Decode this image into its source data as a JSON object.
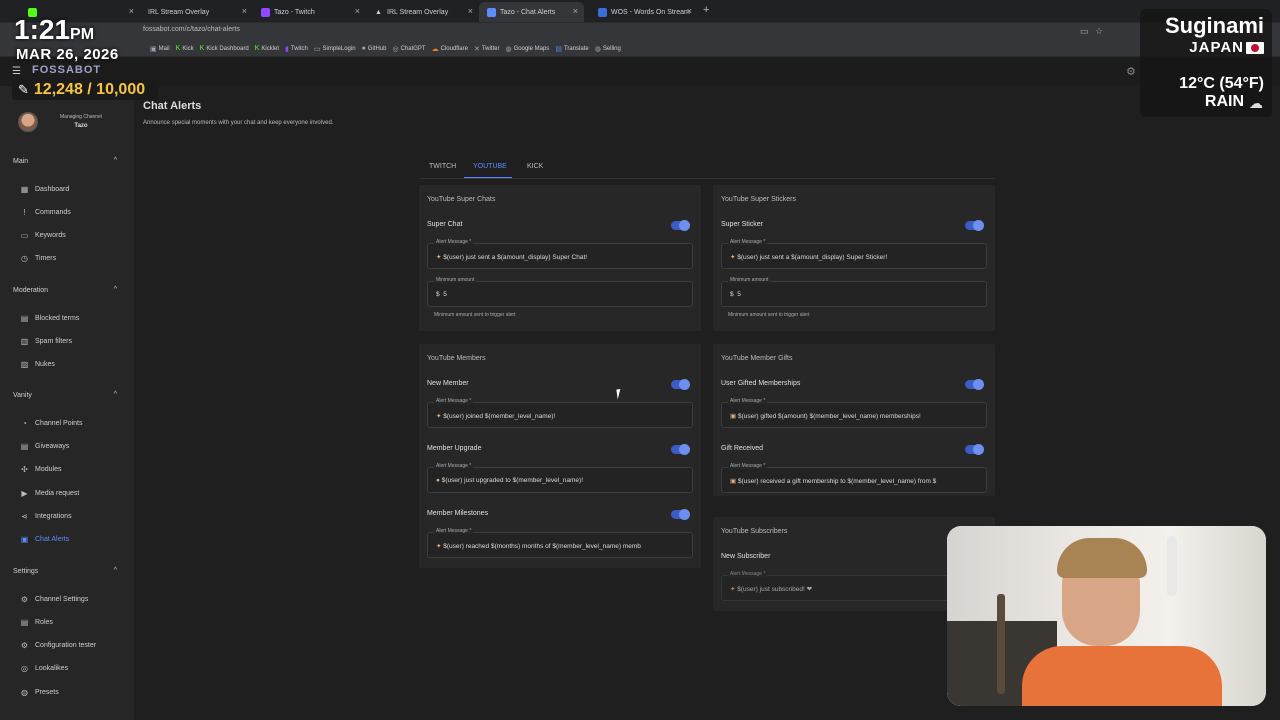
{
  "browser": {
    "tabs": [
      {
        "label": "",
        "icon": "kick-icon"
      },
      {
        "label": "IRL Stream Overlay",
        "icon": "overlay-icon"
      },
      {
        "label": "Tazo - Twitch",
        "icon": "twitch-icon"
      },
      {
        "label": "IRL Stream Overlay",
        "icon": "overlay-icon"
      },
      {
        "label": "Tazo - Chat Alerts",
        "icon": "fossabot-icon"
      },
      {
        "label": "WOS - Words On Stream",
        "icon": "wos-icon"
      }
    ],
    "url": "fossabot.com/c/tazo/chat-alerts",
    "bookmarks": [
      "Mail",
      "Kick",
      "Kick Dashboard",
      "Kicklet",
      "Twitch",
      "SimpleLogin",
      "GitHub",
      "ChatGPT",
      "Cloudflare",
      "Twitter",
      "Google Maps",
      "Translate",
      "Selling"
    ]
  },
  "app": {
    "logo": "FOSSABOT",
    "profile": {
      "caption": "Managing Channel",
      "name": "Tazo"
    }
  },
  "sidebar": {
    "sections": [
      {
        "title": "Main",
        "items": [
          "Dashboard",
          "Commands",
          "Keywords",
          "Timers"
        ]
      },
      {
        "title": "Moderation",
        "items": [
          "Blocked terms",
          "Spam filters",
          "Nukes"
        ]
      },
      {
        "title": "Vanity",
        "items": [
          "Channel Points",
          "Giveaways",
          "Modules",
          "Media request",
          "Integrations",
          "Chat Alerts"
        ]
      },
      {
        "title": "Settings",
        "items": [
          "Channel Settings",
          "Roles",
          "Configuration tester",
          "Lookalikes",
          "Presets"
        ]
      }
    ]
  },
  "page": {
    "title": "Chat Alerts",
    "subtitle": "Announce special moments with your chat and keep everyone involved.",
    "tabs": [
      "TWITCH",
      "YOUTUBE",
      "KICK"
    ],
    "active_tab": "YOUTUBE"
  },
  "cards": {
    "super_chats": {
      "title": "YouTube Super Chats",
      "label": "Super Chat",
      "alert_label": "Alert Message *",
      "alert_value": "$(user) just sent a $(amount_display) Super Chat!",
      "min_label": "Minimum amount",
      "currency": "$",
      "min_value": "5",
      "hint": "Minimum amount sent to trigger alert"
    },
    "super_stickers": {
      "title": "YouTube Super Stickers",
      "label": "Super Sticker",
      "alert_label": "Alert Message *",
      "alert_value": "$(user) just sent a $(amount_display) Super Sticker!",
      "min_label": "Minimum amount",
      "currency": "$",
      "min_value": "5",
      "hint": "Minimum amount sent to trigger alert"
    },
    "members": {
      "title": "YouTube Members",
      "new_member": {
        "label": "New Member",
        "alert_label": "Alert Message *",
        "alert_value": "$(user) joined $(member_level_name)!"
      },
      "upgrade": {
        "label": "Member Upgrade",
        "alert_label": "Alert Message *",
        "alert_value": "$(user) just upgraded to $(member_level_name)!"
      },
      "milestones": {
        "label": "Member Milestones",
        "alert_label": "Alert Message *",
        "alert_value": "$(user) reached $(months) months of $(member_level_name) memb"
      }
    },
    "gifts": {
      "title": "YouTube Member Gifts",
      "gifted": {
        "label": "User Gifted Memberships",
        "alert_label": "Alert Message *",
        "alert_value": "$(user) gifted $(amount) $(member_level_name) memberships!"
      },
      "received": {
        "label": "Gift Received",
        "alert_label": "Alert Message *",
        "alert_value": "$(user) received a gift membership to $(member_level_name) from $"
      }
    },
    "subscribers": {
      "title": "YouTube Subscribers",
      "label": "New Subscriber",
      "alert_label": "Alert Message *",
      "alert_value": "$(user) just subscribed! ❤"
    }
  },
  "overlay": {
    "time": "1:21",
    "ampm": "PM",
    "date": "MAR 26, 2026",
    "counter": "12,248 / 10,000",
    "city": "Suginami",
    "country": "JAPAN",
    "temperature": "12°C (54°F)",
    "weather": "RAIN"
  },
  "colors": {
    "accent": "#5b8dff",
    "toggle": "#3b5cc4",
    "counter": "#f5c542",
    "background": "#1f1f1f"
  }
}
